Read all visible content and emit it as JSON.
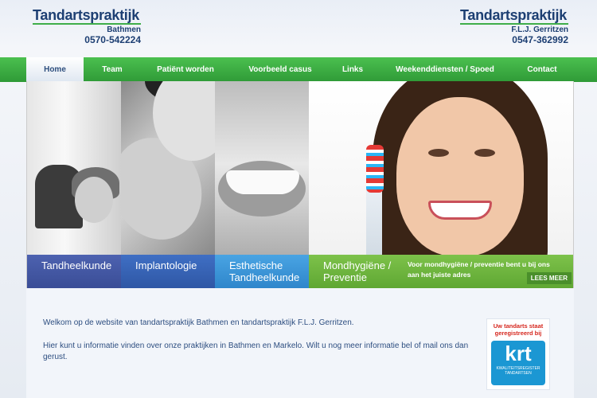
{
  "header": {
    "left_logo": {
      "brand": "Tandartspraktijk",
      "sub": "Bathmen",
      "phone": "0570-542224"
    },
    "right_logo": {
      "brand": "Tandartspraktijk",
      "sub": "F.L.J. Gerritzen",
      "phone": "0547-362992"
    }
  },
  "nav": {
    "items": [
      {
        "label": "Home",
        "active": true
      },
      {
        "label": "Team"
      },
      {
        "label": "Patiënt worden"
      },
      {
        "label": "Voorbeeld casus"
      },
      {
        "label": "Links"
      },
      {
        "label": "Weekenddiensten / Spoed"
      },
      {
        "label": "Contact"
      }
    ]
  },
  "hero": {
    "panels": [
      {
        "caption": "Tandheelkunde"
      },
      {
        "caption": "Implantologie"
      },
      {
        "caption": "Esthetische Tandheelkunde"
      },
      {
        "caption": "Mondhygiëne / Preventie",
        "text": "Voor mondhygiëne / preventie bent u bij ons aan het juiste adres",
        "button": "LEES MEER"
      }
    ]
  },
  "content": {
    "welcome": "Welkom op de website van tandartspraktijk Bathmen en tandartspraktijk F.L.J. Gerritzen.",
    "info": "Hier kunt u informatie vinden over onze praktijken in Bathmen en Markelo. Wilt u nog meer informatie bel of mail ons dan gerust."
  },
  "krt": {
    "top": "Uw tandarts staat geregistreerd bij",
    "logo": "krt",
    "sub": "KWALITEITSREGISTER TANDARTSEN"
  },
  "colors": {
    "nav_green": "#3fae49",
    "brand_blue": "#1d3f73",
    "text_blue": "#2d4e80"
  }
}
